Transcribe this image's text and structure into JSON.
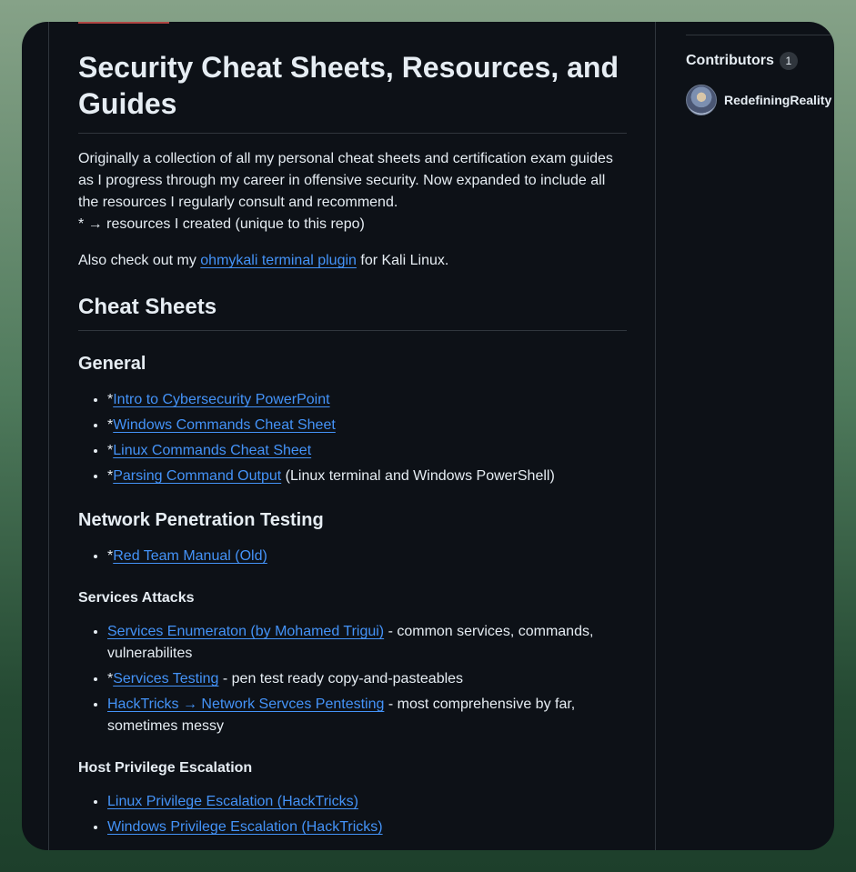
{
  "readme": {
    "title": "Security Cheat Sheets, Resources, and Guides",
    "intro_line1": "Originally a collection of all my personal cheat sheets and certification exam guides as I progress through my career in offensive security. Now expanded to include all the resources I regularly consult and recommend.",
    "intro_line2": "* → resources I created (unique to this repo)",
    "also_prefix": "Also check out my ",
    "also_link": "ohmykali terminal plugin",
    "also_suffix": " for Kali Linux.",
    "sections": {
      "cheat_sheets": "Cheat Sheets",
      "general": "General",
      "network_pentest": "Network Penetration Testing",
      "services_attacks": "Services Attacks",
      "host_privesc": "Host Privilege Escalation"
    },
    "general_items": [
      {
        "prefix": "*",
        "link": "Intro to Cybersecurity PowerPoint",
        "suffix": ""
      },
      {
        "prefix": "*",
        "link": "Windows Commands Cheat Sheet",
        "suffix": ""
      },
      {
        "prefix": "*",
        "link": "Linux Commands Cheat Sheet",
        "suffix": ""
      },
      {
        "prefix": "*",
        "link": "Parsing Command Output",
        "suffix": " (Linux terminal and Windows PowerShell)"
      }
    ],
    "network_items": [
      {
        "prefix": "*",
        "link": "Red Team Manual (Old)",
        "suffix": ""
      }
    ],
    "services_items": [
      {
        "prefix": "",
        "link": "Services Enumeraton (by Mohamed Trigui)",
        "suffix": " - common services, commands, vulnerabilites"
      },
      {
        "prefix": "*",
        "link": "Services Testing",
        "suffix": " - pen test ready copy-and-pasteables"
      },
      {
        "prefix": "",
        "link": "HackTricks → Network Servces Pentesting",
        "suffix": " - most comprehensive by far, sometimes messy"
      }
    ],
    "privesc_items": [
      {
        "prefix": "",
        "link": "Linux Privilege Escalation (HackTricks)",
        "suffix": ""
      },
      {
        "prefix": "",
        "link": "Windows Privilege Escalation (HackTricks)",
        "suffix": ""
      }
    ]
  },
  "sidebar": {
    "contributors_title": "Contributors",
    "contributors_count": "1",
    "contributor_name": "RedefiningReality"
  }
}
